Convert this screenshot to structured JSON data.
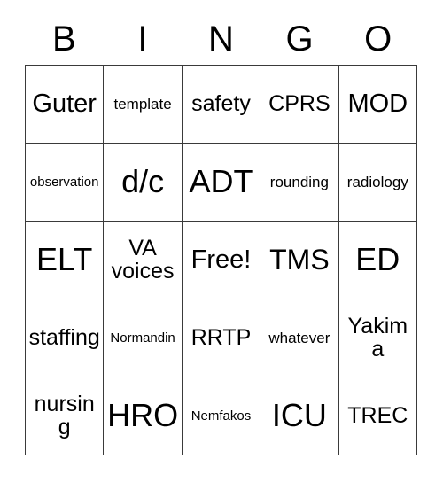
{
  "card": {
    "title": "BINGO",
    "header_letters": [
      "B",
      "I",
      "N",
      "G",
      "O"
    ],
    "rows": [
      [
        {
          "text": "Guter",
          "size": "lg"
        },
        {
          "text": "template",
          "size": "xs"
        },
        {
          "text": "safety",
          "size": "md"
        },
        {
          "text": "CPRS",
          "size": "md"
        },
        {
          "text": "MOD",
          "size": "lg"
        }
      ],
      [
        {
          "text": "observation",
          "size": "xxs"
        },
        {
          "text": "d/c",
          "size": "xxl"
        },
        {
          "text": "ADT",
          "size": "xxl"
        },
        {
          "text": "rounding",
          "size": "xs"
        },
        {
          "text": "radiology",
          "size": "xs"
        }
      ],
      [
        {
          "text": "ELT",
          "size": "xxl"
        },
        {
          "text": "VA\nvoices",
          "size": "md"
        },
        {
          "text": "Free!",
          "size": "lg"
        },
        {
          "text": "TMS",
          "size": "xl"
        },
        {
          "text": "ED",
          "size": "xxl"
        }
      ],
      [
        {
          "text": "staffing",
          "size": "md"
        },
        {
          "text": "Normandin",
          "size": "xxs"
        },
        {
          "text": "RRTP",
          "size": "md"
        },
        {
          "text": "whatever",
          "size": "xs"
        },
        {
          "text": "Yakima",
          "size": "md"
        }
      ],
      [
        {
          "text": "nursing",
          "size": "md"
        },
        {
          "text": "HRO",
          "size": "xxl"
        },
        {
          "text": "Nemfakos",
          "size": "xxs"
        },
        {
          "text": "ICU",
          "size": "xxl"
        },
        {
          "text": "TREC",
          "size": "md"
        }
      ]
    ],
    "free_space": {
      "row": 2,
      "col": 2,
      "label": "Free!"
    },
    "colors": {
      "background": "#ffffff",
      "text": "#000000",
      "border": "#3a3a3a"
    }
  }
}
